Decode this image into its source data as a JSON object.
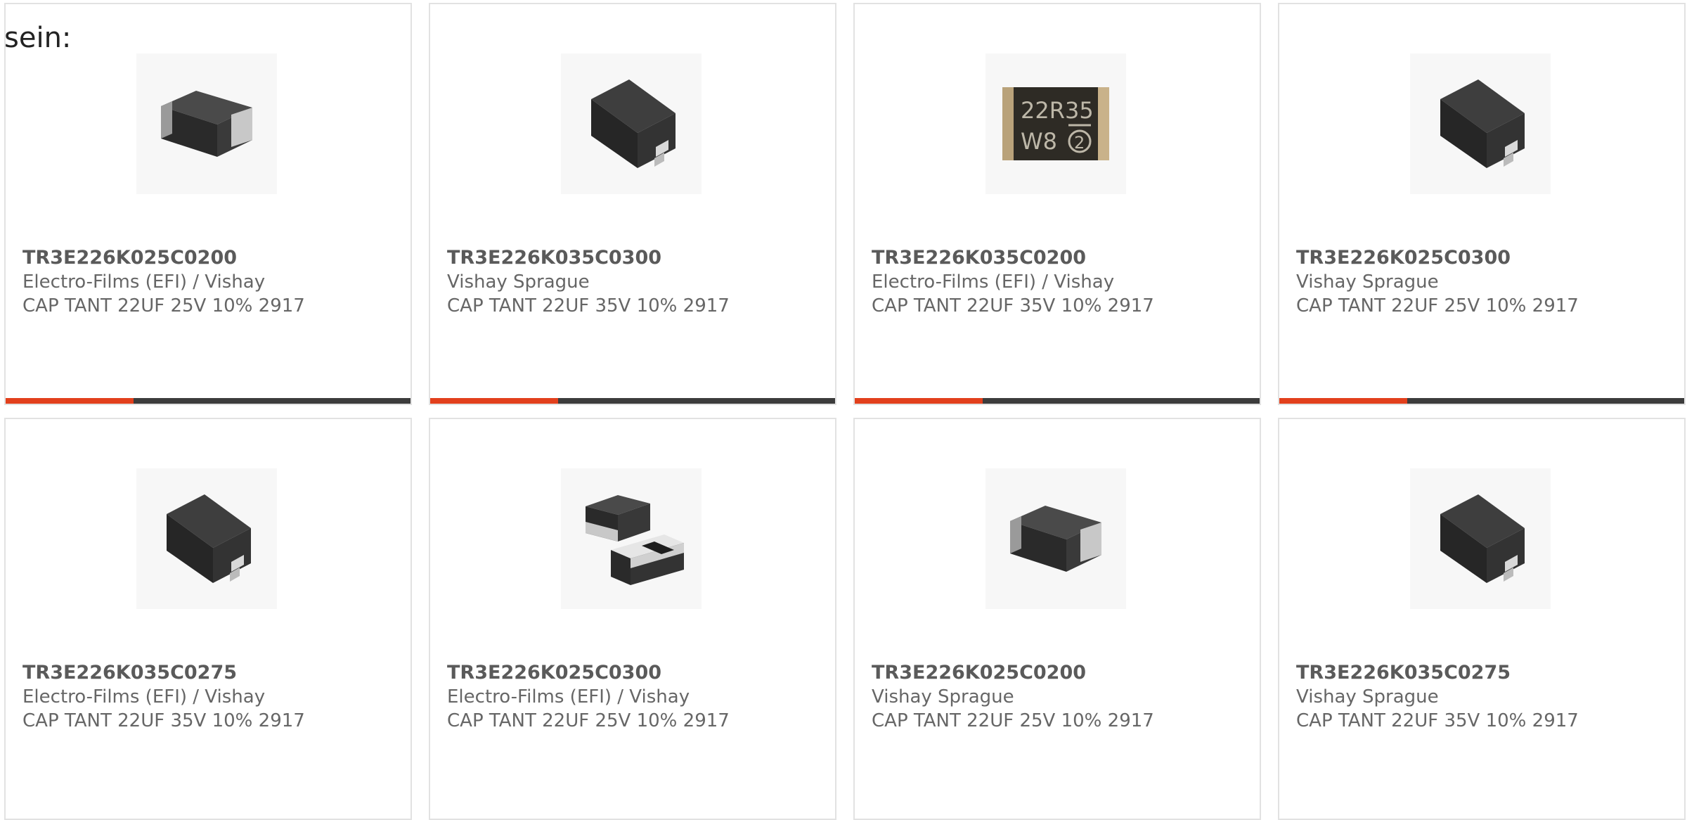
{
  "intro_text": "sein:",
  "colors": {
    "accent": "#e2401c",
    "bar_track": "#3c3c3c",
    "card_border": "#e2e2e2"
  },
  "products": [
    {
      "part_number": "TR3E226K025C0200",
      "manufacturer": "Electro-Films (EFI) / Vishay",
      "description": "CAP TANT 22UF 25V 10% 2917",
      "image_icon": "tantalum-capacitor-silver-band-icon"
    },
    {
      "part_number": "TR3E226K035C0300",
      "manufacturer": "Vishay Sprague",
      "description": "CAP TANT 22UF 35V 10% 2917",
      "image_icon": "tantalum-capacitor-icon"
    },
    {
      "part_number": "TR3E226K035C0200",
      "manufacturer": "Electro-Films (EFI) / Vishay",
      "description": "CAP TANT 22UF 35V 10% 2917",
      "image_icon": "marked-capacitor-top-icon",
      "marking_line1": "22R35",
      "marking_line2": "W8",
      "marking_badge": "2"
    },
    {
      "part_number": "TR3E226K025C0300",
      "manufacturer": "Vishay Sprague",
      "description": "CAP TANT 22UF 25V 10% 2917",
      "image_icon": "tantalum-capacitor-icon"
    },
    {
      "part_number": "TR3E226K035C0275",
      "manufacturer": "Electro-Films (EFI) / Vishay",
      "description": "CAP TANT 22UF 35V 10% 2917",
      "image_icon": "tantalum-capacitor-icon"
    },
    {
      "part_number": "TR3E226K025C0300",
      "manufacturer": "Electro-Films (EFI) / Vishay",
      "description": "CAP TANT 22UF 25V 10% 2917",
      "image_icon": "two-capacitors-icon"
    },
    {
      "part_number": "TR3E226K025C0200",
      "manufacturer": "Vishay Sprague",
      "description": "CAP TANT 22UF 25V 10% 2917",
      "image_icon": "tantalum-capacitor-silver-band-icon"
    },
    {
      "part_number": "TR3E226K035C0275",
      "manufacturer": "Vishay Sprague",
      "description": "CAP TANT 22UF 35V 10% 2917",
      "image_icon": "tantalum-capacitor-icon"
    }
  ]
}
